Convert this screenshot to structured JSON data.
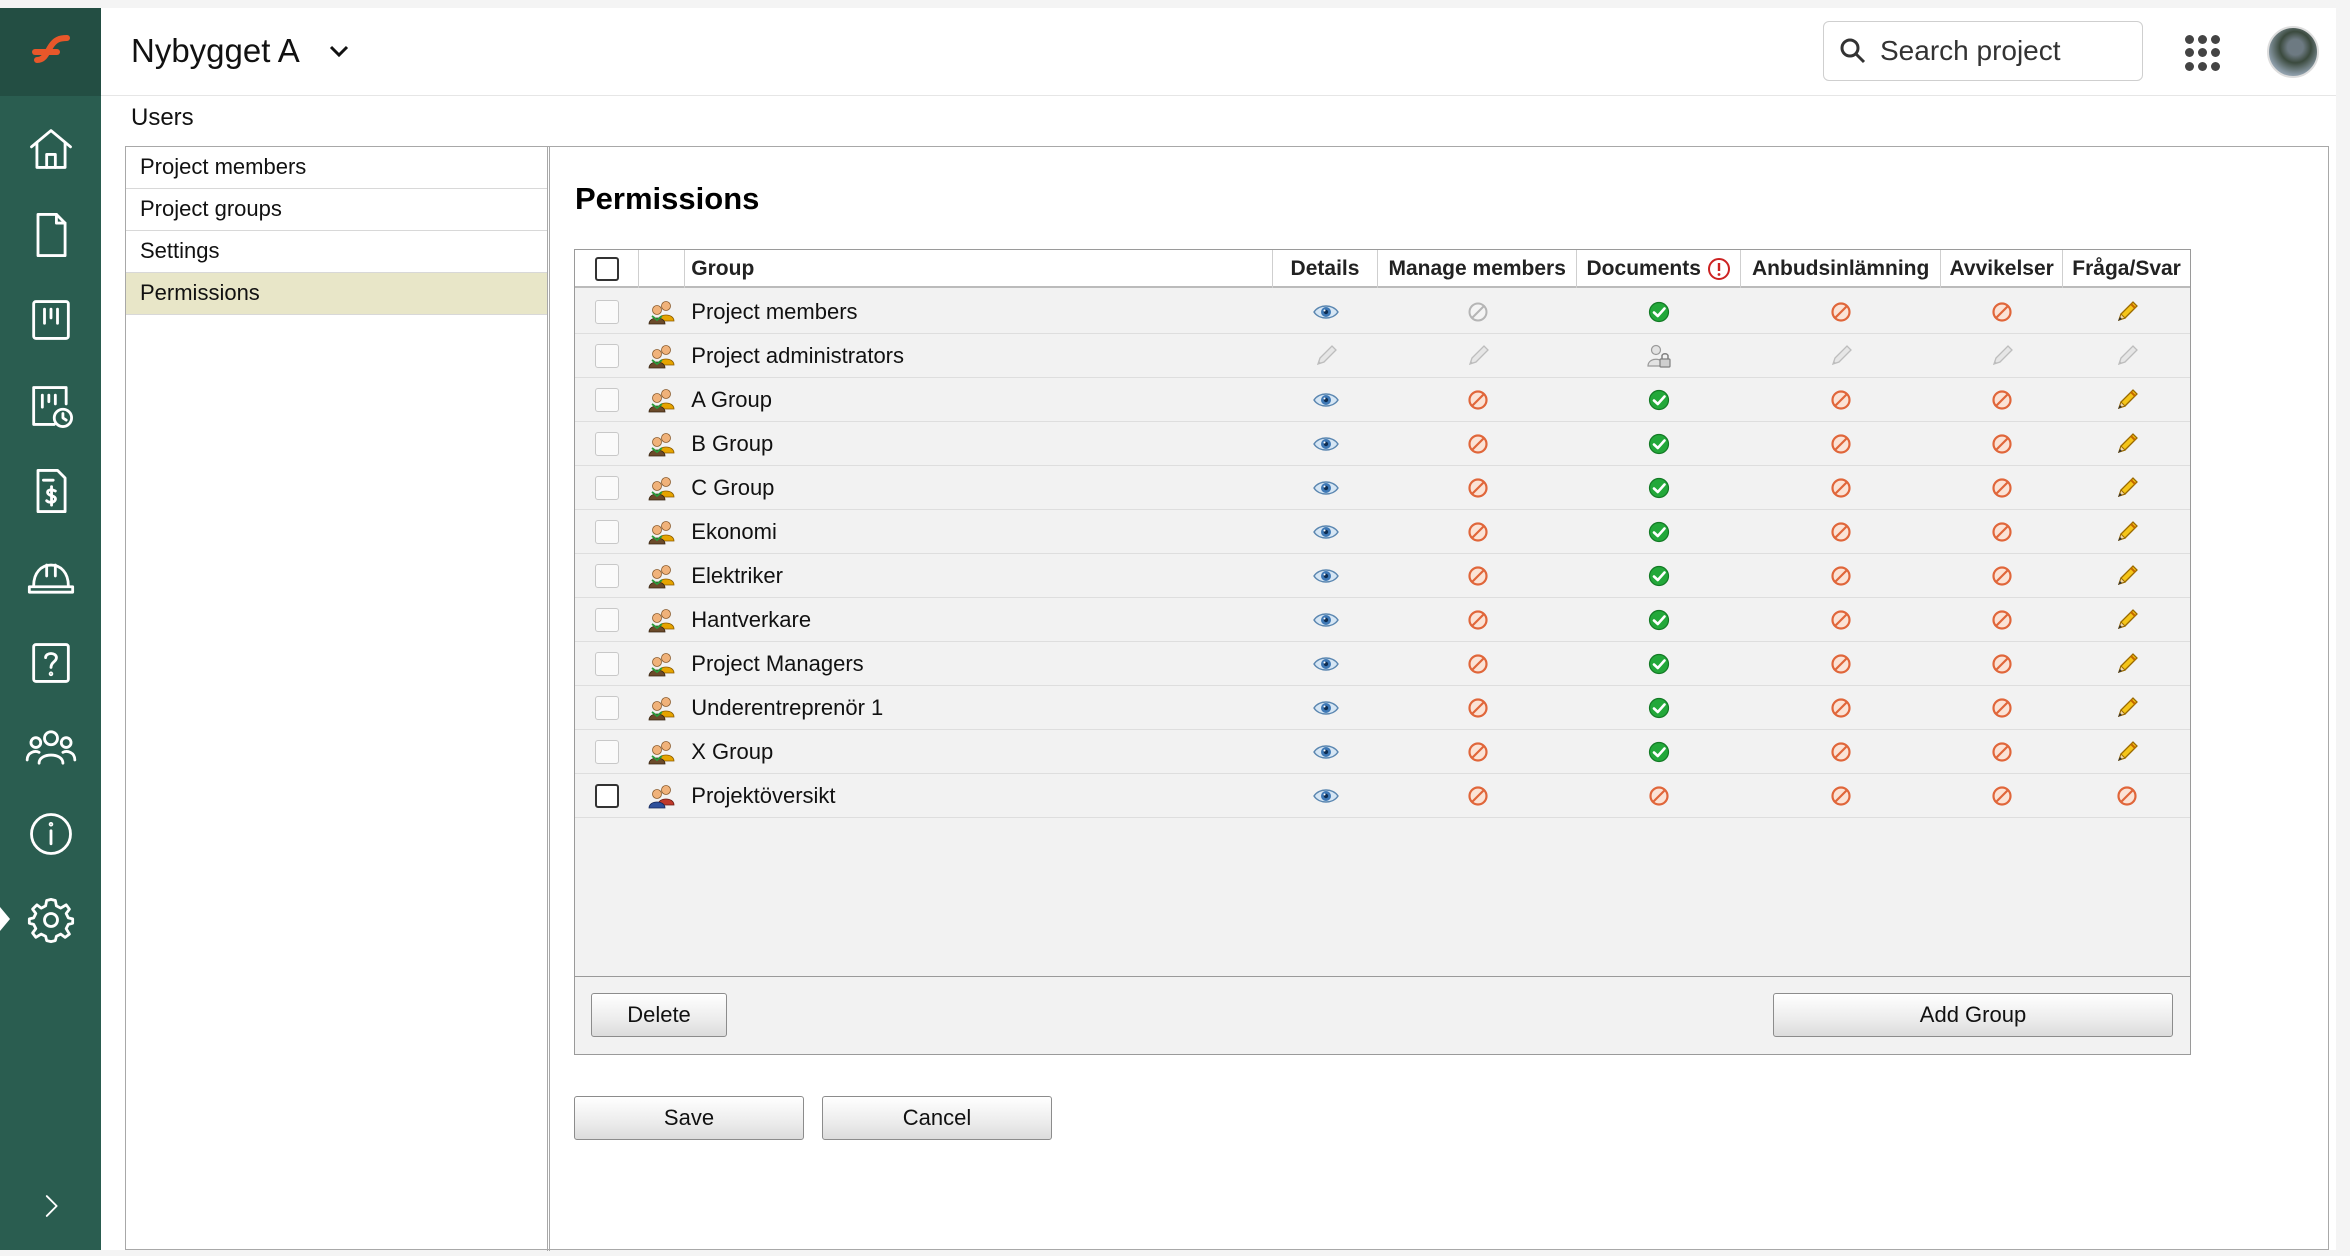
{
  "header": {
    "project_name": "Nybygget A",
    "search_placeholder": "Search project"
  },
  "breadcrumb": "Users",
  "sidebar_nav": [
    {
      "icon": "home-icon"
    },
    {
      "icon": "document-icon"
    },
    {
      "icon": "board-icon"
    },
    {
      "icon": "schedule-icon"
    },
    {
      "icon": "invoice-icon"
    },
    {
      "icon": "hardhat-icon"
    },
    {
      "icon": "question-icon"
    },
    {
      "icon": "users-icon"
    },
    {
      "icon": "info-icon"
    },
    {
      "icon": "gear-icon"
    },
    {
      "icon": "chevron-right-icon"
    }
  ],
  "subnav": {
    "items": [
      "Project members",
      "Project groups",
      "Settings",
      "Permissions"
    ],
    "active": "Permissions"
  },
  "page": {
    "title": "Permissions"
  },
  "table": {
    "columns": {
      "group": "Group",
      "details": "Details",
      "manage_members": "Manage members",
      "documents": "Documents",
      "anbud": "Anbudsinlämning",
      "avvikelser": "Avvikelser",
      "fraga": "Fråga/Svar"
    },
    "rows": [
      {
        "name": "Project members",
        "perms": [
          "view",
          "disabled",
          "allow",
          "deny",
          "deny",
          "edit"
        ]
      },
      {
        "name": "Project administrators",
        "perms": [
          "edit-disabled",
          "edit-disabled",
          "admin-locked",
          "edit-disabled",
          "edit-disabled",
          "edit-disabled"
        ]
      },
      {
        "name": "A Group",
        "perms": [
          "view",
          "deny",
          "allow",
          "deny",
          "deny",
          "edit"
        ]
      },
      {
        "name": "B Group",
        "perms": [
          "view",
          "deny",
          "allow",
          "deny",
          "deny",
          "edit"
        ]
      },
      {
        "name": "C Group",
        "perms": [
          "view",
          "deny",
          "allow",
          "deny",
          "deny",
          "edit"
        ]
      },
      {
        "name": "Ekonomi",
        "perms": [
          "view",
          "deny",
          "allow",
          "deny",
          "deny",
          "edit"
        ]
      },
      {
        "name": "Elektriker",
        "perms": [
          "view",
          "deny",
          "allow",
          "deny",
          "deny",
          "edit"
        ]
      },
      {
        "name": "Hantverkare",
        "perms": [
          "view",
          "deny",
          "allow",
          "deny",
          "deny",
          "edit"
        ]
      },
      {
        "name": "Project Managers",
        "perms": [
          "view",
          "deny",
          "allow",
          "deny",
          "deny",
          "edit"
        ]
      },
      {
        "name": "Underentreprenör 1",
        "perms": [
          "view",
          "deny",
          "allow",
          "deny",
          "deny",
          "edit"
        ]
      },
      {
        "name": "X Group",
        "perms": [
          "view",
          "deny",
          "allow",
          "deny",
          "deny",
          "edit"
        ]
      },
      {
        "name": "Projektöversikt",
        "perms": [
          "view",
          "deny",
          "deny",
          "deny",
          "deny",
          "deny"
        ]
      }
    ]
  },
  "buttons": {
    "delete": "Delete",
    "add_group": "Add Group",
    "save": "Save",
    "cancel": "Cancel"
  },
  "colors": {
    "rail": "#2a5d50",
    "logo_accent": "#e8572a",
    "active_subnav": "#e8e6c8"
  }
}
